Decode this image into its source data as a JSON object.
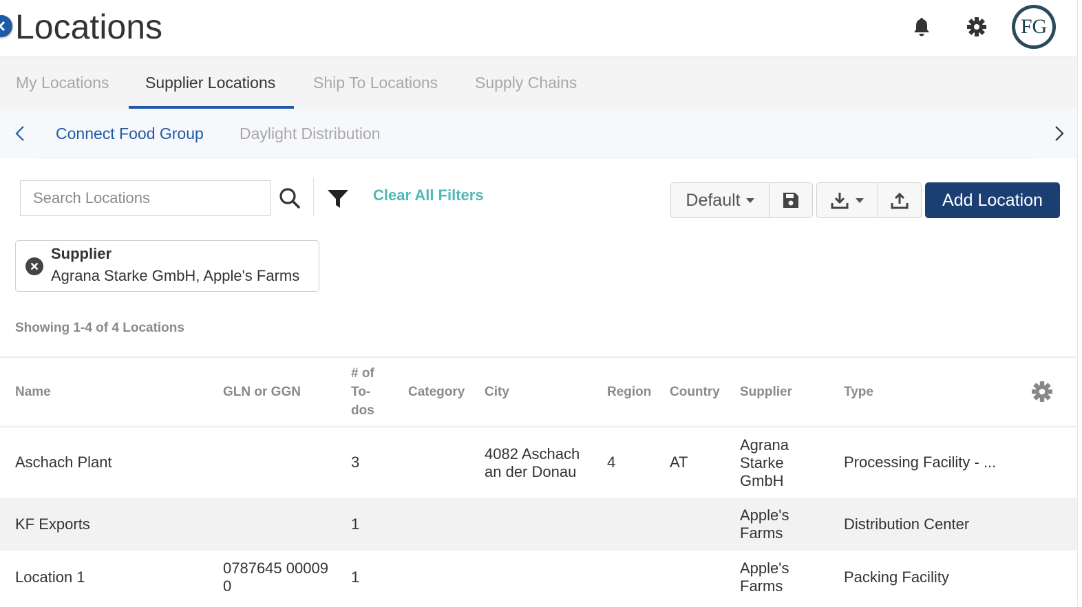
{
  "header": {
    "title": "Locations",
    "avatar_initials": "FG"
  },
  "tabs": [
    {
      "label": "My Locations",
      "active": false
    },
    {
      "label": "Supplier Locations",
      "active": true
    },
    {
      "label": "Ship To Locations",
      "active": false
    },
    {
      "label": "Supply Chains",
      "active": false
    }
  ],
  "subtabs": [
    {
      "label": "Connect Food Group",
      "active": true
    },
    {
      "label": "Daylight Distribution",
      "active": false
    }
  ],
  "toolbar": {
    "search_placeholder": "Search Locations",
    "search_value": "",
    "clear_filters_label": "Clear All Filters",
    "view_select_label": "Default",
    "add_button_label": "Add Location"
  },
  "filter_chip": {
    "title": "Supplier",
    "value": "Agrana Starke GmbH, Apple's Farms"
  },
  "showing_text": "Showing 1-4 of 4 Locations",
  "table": {
    "columns": {
      "name": "Name",
      "gln": "GLN or GGN",
      "todos": "# of To- dos",
      "todos_lines": [
        "# of",
        "To-",
        "dos"
      ],
      "category": "Category",
      "city": "City",
      "region": "Region",
      "country": "Country",
      "supplier": "Supplier",
      "type": "Type"
    },
    "rows": [
      {
        "name": "Aschach Plant",
        "gln": "",
        "todos": "3",
        "category": "",
        "city_lines": [
          "4082 Aschach",
          "an der Donau"
        ],
        "region": "4",
        "country": "AT",
        "supplier_lines": [
          "Agrana",
          "Starke",
          "GmbH"
        ],
        "type": "Processing Facility - ..."
      },
      {
        "name": "KF Exports",
        "gln": "",
        "todos": "1",
        "category": "",
        "city_lines": [],
        "region": "",
        "country": "",
        "supplier_lines": [
          "Apple's",
          "Farms"
        ],
        "type": "Distribution Center"
      },
      {
        "name": "Location 1",
        "gln_lines": [
          "0787645 00009",
          "0"
        ],
        "todos": "1",
        "category": "",
        "city_lines": [],
        "region": "",
        "country": "",
        "supplier_lines": [
          "Apple's",
          "Farms"
        ],
        "type": "Packing Facility"
      }
    ]
  },
  "colors": {
    "primary": "#1f5aa6",
    "add_button": "#1b3f73",
    "clear_filters": "#4fb8b8",
    "tab_bar": "#f4f4f4",
    "alt_row": "#f2f2f2"
  },
  "icons": {
    "back": "chevron-left-circle-icon",
    "notifications": "bell-icon",
    "settings": "gear-icon",
    "search": "search-icon",
    "filter": "filter-funnel-icon",
    "save": "floppy-disk-icon",
    "download": "download-icon",
    "upload": "upload-icon",
    "remove_filter": "close-circle-icon",
    "columns": "gear-icon"
  }
}
